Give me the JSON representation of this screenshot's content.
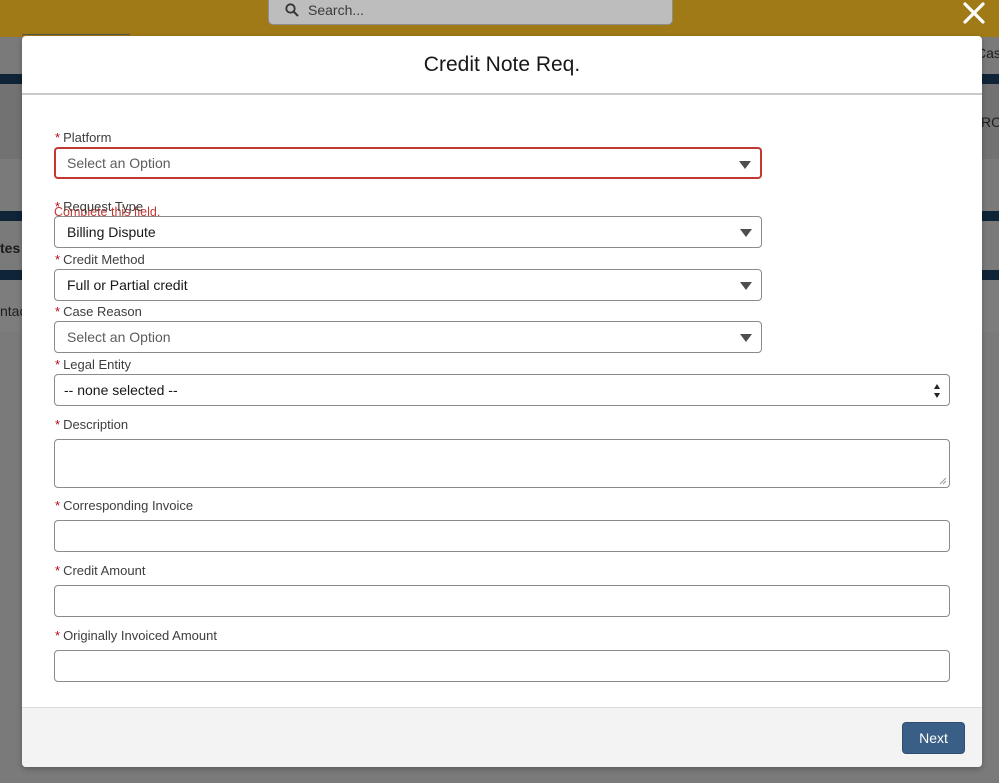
{
  "background": {
    "search_placeholder": "Search...",
    "fragments": [
      "Cas",
      "RO",
      "tes",
      "ntac"
    ]
  },
  "modal": {
    "title": "Credit Note Req.",
    "close_icon": "close-icon"
  },
  "form": {
    "required_marker": "*",
    "platform": {
      "label": "Platform",
      "placeholder": "Select an Option",
      "error": "Complete this field."
    },
    "request_type": {
      "label": "Request Type",
      "value": "Billing Dispute"
    },
    "credit_method": {
      "label": "Credit Method",
      "value": "Full or Partial credit"
    },
    "case_reason": {
      "label": "Case Reason",
      "placeholder": "Select an Option"
    },
    "legal_entity": {
      "label": "Legal Entity",
      "value": "-- none selected --"
    },
    "description": {
      "label": "Description",
      "value": ""
    },
    "corresponding_invoice": {
      "label": "Corresponding Invoice",
      "value": ""
    },
    "credit_amount": {
      "label": "Credit Amount",
      "value": ""
    },
    "originally_invoiced_amount": {
      "label": "Originally Invoiced Amount",
      "value": ""
    }
  },
  "footer": {
    "next_label": "Next"
  },
  "colors": {
    "error": "#c23934",
    "required": "#ba0517",
    "brand_button": "#3a5f86",
    "overlay_header": "#a07a16"
  }
}
